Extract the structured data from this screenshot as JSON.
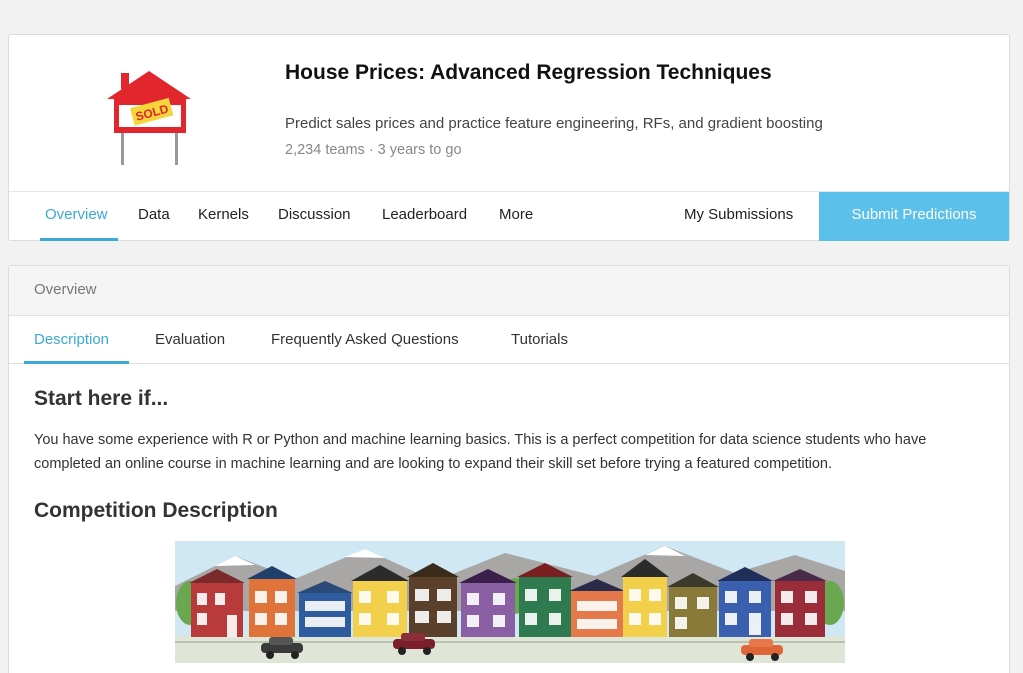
{
  "competition": {
    "title": "House Prices: Advanced Regression Techniques",
    "subtitle": "Predict sales prices and practice feature engineering, RFs, and gradient boosting",
    "meta": "2,234 teams · 3 years to go",
    "logo_sign_text": "SOLD",
    "logo_icon": "house-for-sale-sign"
  },
  "nav": {
    "tabs": [
      {
        "label": "Overview",
        "active": true
      },
      {
        "label": "Data"
      },
      {
        "label": "Kernels"
      },
      {
        "label": "Discussion"
      },
      {
        "label": "Leaderboard"
      },
      {
        "label": "More"
      }
    ],
    "my_submissions": "My Submissions",
    "submit": "Submit Predictions"
  },
  "overview": {
    "section_label": "Overview",
    "subtabs": [
      {
        "label": "Description",
        "active": true
      },
      {
        "label": "Evaluation"
      },
      {
        "label": "Frequently Asked Questions"
      },
      {
        "label": "Tutorials"
      }
    ],
    "heading1": "Start here if...",
    "paragraph1": "You have some experience with R or Python and machine learning basics. This is a perfect competition for data science students who have completed an online course in machine learning and are looking to expand their skill set before trying a featured competition.",
    "heading2": "Competition Description",
    "banner_icon": "colorful-houses-street-illustration"
  },
  "colors": {
    "accent": "#3ba9d4",
    "submit_bg": "#5bc0ea"
  }
}
